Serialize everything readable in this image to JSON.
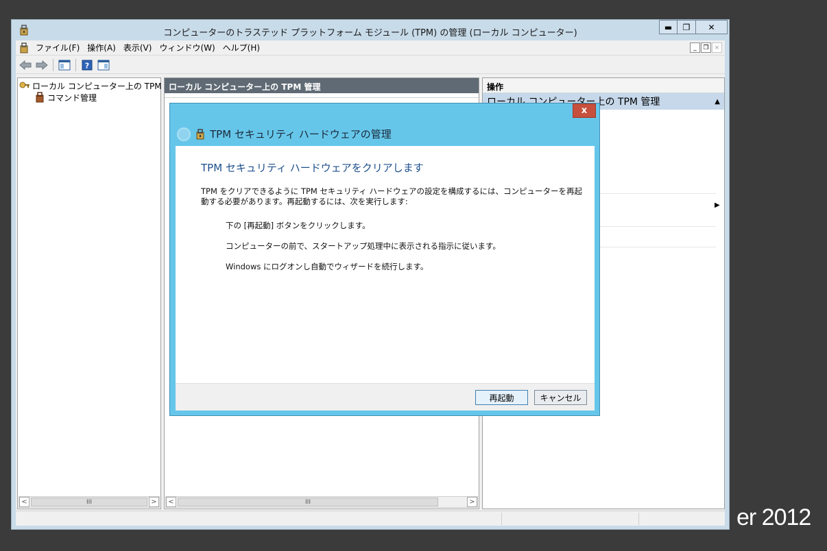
{
  "window": {
    "title": "コンピューターのトラステッド プラットフォーム モジュール (TPM) の管理 (ローカル コンピューター)",
    "controls": {
      "minimize": "▬",
      "restore": "❐",
      "close": "✕"
    }
  },
  "menu": {
    "items": [
      "ファイル(F)",
      "操作(A)",
      "表示(V)",
      "ウィンドウ(W)",
      "ヘルプ(H)"
    ],
    "mdi": {
      "minimize": "_",
      "restore": "❐",
      "close": "×"
    }
  },
  "tree": {
    "root_label": "ローカル コンピューター上の TPM 管理",
    "child_label": "コマンド管理"
  },
  "center": {
    "header": "ローカル コンピューター上の TPM 管理"
  },
  "actions": {
    "header": "操作",
    "section": "ローカル コンピューター上の TPM 管理",
    "section_arrow": "▲",
    "submenu_arrow": "▶"
  },
  "scroll": {
    "left": "<",
    "right": ">",
    "thumb": "III"
  },
  "dialog": {
    "close": "x",
    "title": "TPM セキュリティ ハードウェアの管理",
    "heading": "TPM セキュリティ ハードウェアをクリアします",
    "intro": "TPM をクリアできるように TPM セキュリティ ハードウェアの設定を構成するには、コンピューターを再起動する必要があります。再起動するには、次を実行します:",
    "steps": [
      "下の [再起動] ボタンをクリックします。",
      "コンピューターの前で、スタートアップ処理中に表示される指示に従います。",
      "Windows にログオンし自動でウィザードを続行します。"
    ],
    "restart_button": "再起動",
    "cancel_button": "キャンセル"
  },
  "desktop": {
    "brand_fragment": "er 2012"
  }
}
